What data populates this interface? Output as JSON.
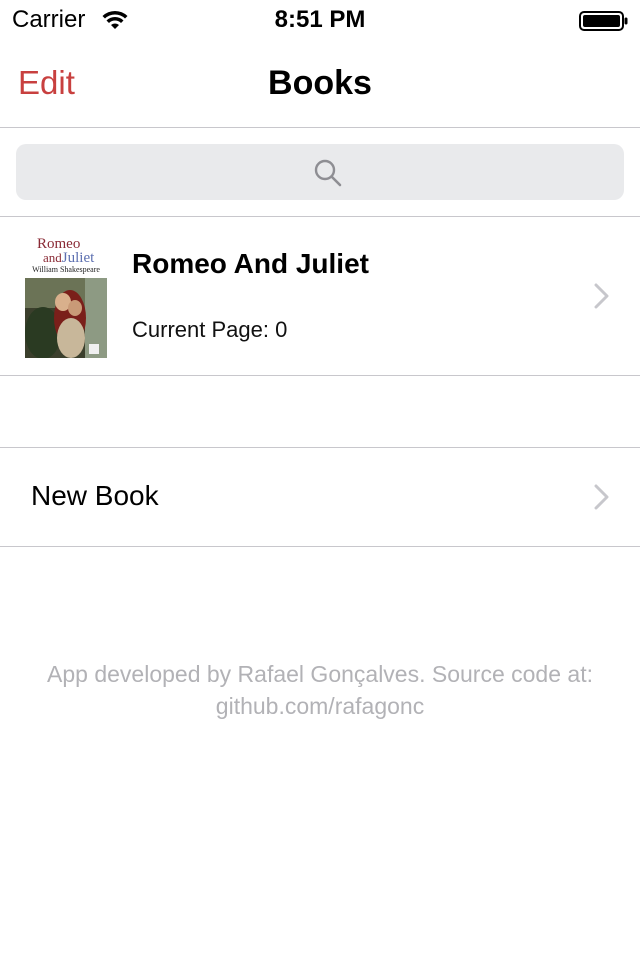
{
  "status_bar": {
    "carrier": "Carrier",
    "time": "8:51 PM"
  },
  "nav": {
    "edit_label": "Edit",
    "title": "Books"
  },
  "search": {
    "placeholder": ""
  },
  "books": [
    {
      "title": "Romeo And Juliet",
      "current_page_label": "Current Page: 0",
      "cover": {
        "line1": "Romeo",
        "line2_and": "and",
        "line2_juliet": "Juliet",
        "author": "William Shakespeare"
      }
    }
  ],
  "new_book": {
    "label": "New Book"
  },
  "footer": {
    "text": "App developed by Rafael Gonçalves. Source code at: github.com/rafagonc"
  },
  "colors": {
    "accent": "#c8403f",
    "separator": "#c8c7cc",
    "footer_text": "#b2b2b6",
    "search_bg": "#e9eaec"
  }
}
